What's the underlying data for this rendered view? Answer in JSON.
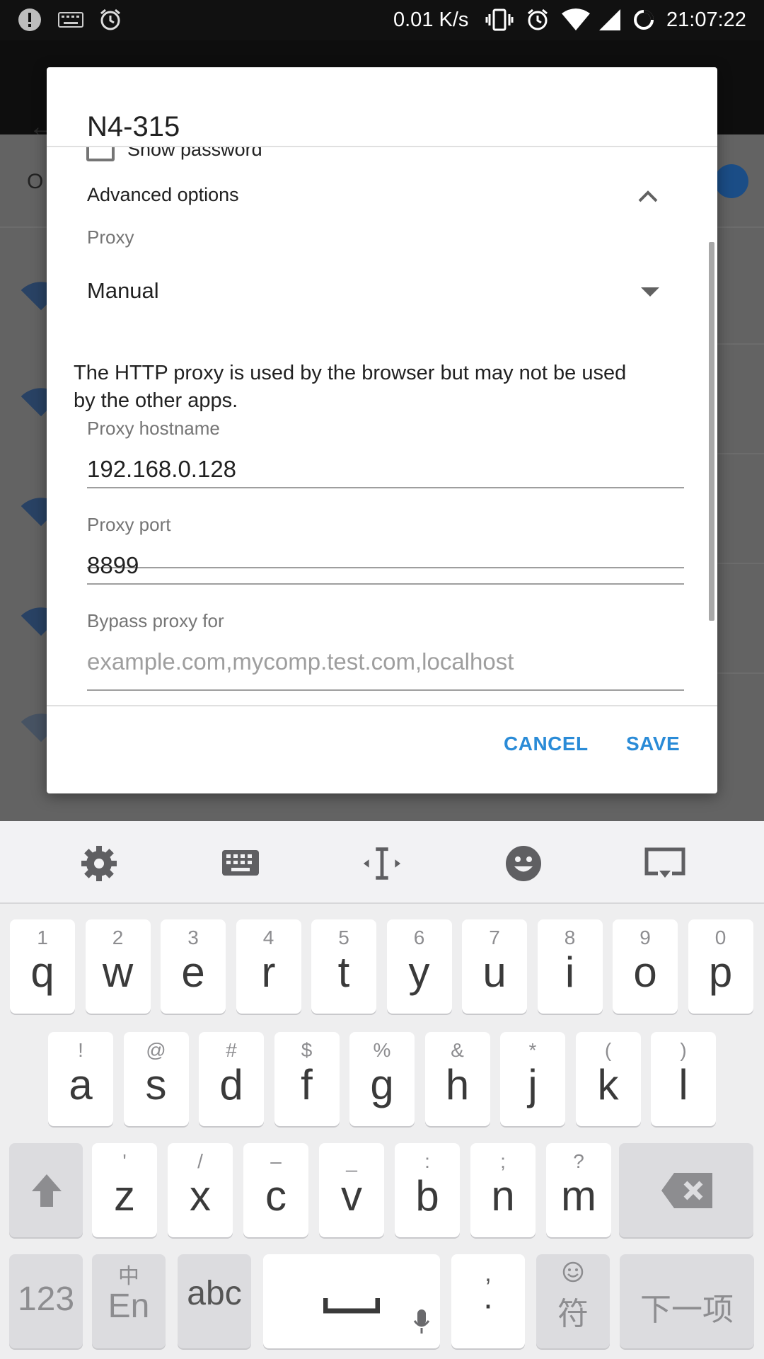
{
  "status_bar": {
    "speed": "0.01 K/s",
    "time": "21:07:22",
    "icons": [
      "alert-icon",
      "keyboard-icon",
      "alarm-icon",
      "vibrate-icon",
      "alarm-icon",
      "wifi-icon",
      "signal-icon",
      "loading-icon"
    ]
  },
  "background_app": {
    "partial_label": "O"
  },
  "dialog": {
    "title": "N4-315",
    "show_password_label": "Show password",
    "advanced_options_label": "Advanced options",
    "proxy": {
      "caption": "Proxy",
      "value": "Manual"
    },
    "proxy_note": "The HTTP proxy is used by the browser but may not be used by the other apps.",
    "hostname": {
      "caption": "Proxy hostname",
      "value": "192.168.0.128"
    },
    "port": {
      "caption": "Proxy port",
      "value": "8899"
    },
    "bypass": {
      "caption": "Bypass proxy for",
      "placeholder": "example.com,mycomp.test.com,localhost"
    },
    "cancel_label": "CANCEL",
    "save_label": "SAVE",
    "accent_color": "#2a8bd7"
  },
  "keyboard": {
    "toolbar_icons": [
      "settings-icon",
      "keyboard-layout-icon",
      "cursor-icon",
      "emoji-icon",
      "hide-keyboard-icon"
    ],
    "row1": [
      {
        "main": "q",
        "sub": "1"
      },
      {
        "main": "w",
        "sub": "2"
      },
      {
        "main": "e",
        "sub": "3"
      },
      {
        "main": "r",
        "sub": "4"
      },
      {
        "main": "t",
        "sub": "5"
      },
      {
        "main": "y",
        "sub": "6"
      },
      {
        "main": "u",
        "sub": "7"
      },
      {
        "main": "i",
        "sub": "8"
      },
      {
        "main": "o",
        "sub": "9"
      },
      {
        "main": "p",
        "sub": "0"
      }
    ],
    "row2": [
      {
        "main": "a",
        "sub": "!"
      },
      {
        "main": "s",
        "sub": "@"
      },
      {
        "main": "d",
        "sub": "#"
      },
      {
        "main": "f",
        "sub": "$"
      },
      {
        "main": "g",
        "sub": "%"
      },
      {
        "main": "h",
        "sub": "&"
      },
      {
        "main": "j",
        "sub": "*"
      },
      {
        "main": "k",
        "sub": "("
      },
      {
        "main": "l",
        "sub": ")"
      }
    ],
    "row3": [
      {
        "main": "z",
        "sub": "'"
      },
      {
        "main": "x",
        "sub": "/"
      },
      {
        "main": "c",
        "sub": "–"
      },
      {
        "main": "v",
        "sub": "_"
      },
      {
        "main": "b",
        "sub": ":"
      },
      {
        "main": "n",
        "sub": ";"
      },
      {
        "main": "m",
        "sub": "?"
      }
    ],
    "bottom": {
      "num": "123",
      "lang_top": "中",
      "lang_main": "En",
      "abc": "abc",
      "comma": ",",
      "period": "·",
      "symbol": "符",
      "next": "下一项"
    }
  }
}
